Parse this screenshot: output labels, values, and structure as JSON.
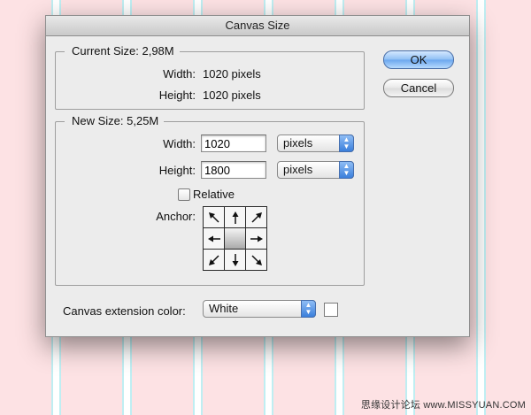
{
  "dialog": {
    "title": "Canvas Size",
    "ok_label": "OK",
    "cancel_label": "Cancel"
  },
  "current_size": {
    "title": "Current Size: 2,98M",
    "width_label": "Width:",
    "width_value": "1020 pixels",
    "height_label": "Height:",
    "height_value": "1020 pixels"
  },
  "new_size": {
    "title": "New Size: 5,25M",
    "width_label": "Width:",
    "width_value": "1020",
    "width_unit": "pixels",
    "height_label": "Height:",
    "height_value": "1800",
    "height_unit": "pixels",
    "relative_label": "Relative",
    "relative_checked": false,
    "anchor_label": "Anchor:"
  },
  "extension": {
    "label": "Canvas extension color:",
    "selected": "White",
    "swatch_color": "#ffffff"
  },
  "colors": {
    "background_pink": "#fde2e4",
    "stripe_cyan": "#bfeef2",
    "default_button_blue": "#8ebff4"
  },
  "watermark": "思缘设计论坛 www.MISSYUAN.COM"
}
